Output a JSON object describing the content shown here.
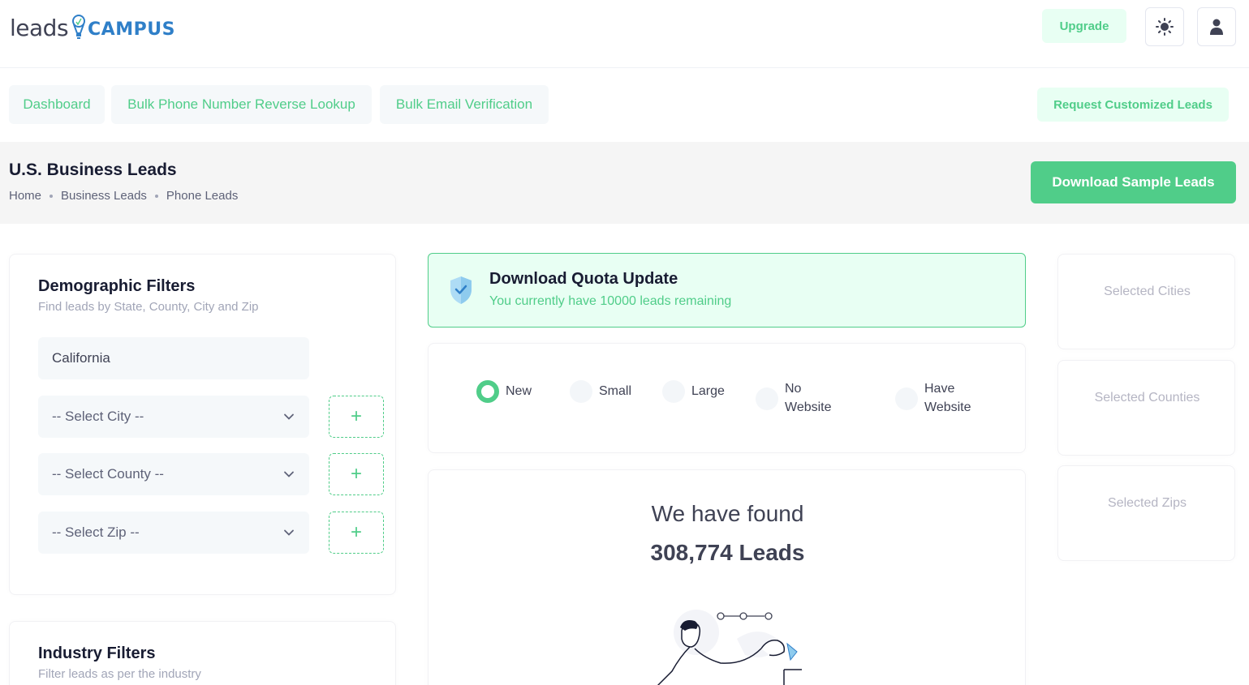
{
  "brand": {
    "leads": "leads",
    "campus": "CAMPUS",
    "campus_color": "#2f7fc8"
  },
  "header": {
    "upgrade_label": "Upgrade",
    "theme_icon": "sun-icon",
    "user_icon": "user-icon"
  },
  "nav": {
    "dashboard": "Dashboard",
    "phone_lookup": "Bulk Phone Number Reverse Lookup",
    "email_verification": "Bulk Email Verification",
    "request_leads": "Request Customized Leads"
  },
  "toolbar": {
    "title": "U.S. Business Leads",
    "breadcrumb": [
      "Home",
      "Business Leads",
      "Phone Leads"
    ],
    "download_label": "Download Sample Leads"
  },
  "demographic": {
    "title": "Demographic Filters",
    "subtitle": "Find leads by State, County, City and Zip",
    "state": "California",
    "city_placeholder": "-- Select City --",
    "county_placeholder": "-- Select County --",
    "zip_placeholder": "-- Select Zip --",
    "add_symbol": "+"
  },
  "industry": {
    "title": "Industry Filters",
    "subtitle": "Filter leads as per the industry"
  },
  "quota": {
    "title": "Download Quota Update",
    "text": "You currently have 10000 leads remaining"
  },
  "options": [
    {
      "line1": "New",
      "line2": "",
      "selected": true
    },
    {
      "line1": "Small",
      "line2": "",
      "selected": false
    },
    {
      "line1": "Large",
      "line2": "",
      "selected": false
    },
    {
      "line1": "No",
      "line2": "Website",
      "selected": false
    },
    {
      "line1": "Have",
      "line2": "Website",
      "selected": false
    }
  ],
  "found": {
    "line1": "We have found",
    "count": "308,774 Leads"
  },
  "side": {
    "cities": "Selected Cities",
    "counties": "Selected Counties",
    "zips": "Selected Zips"
  },
  "colors": {
    "accent": "#50cd89",
    "accent_light": "#e8fff3",
    "toolbar_bg": "#f5f5f5"
  }
}
